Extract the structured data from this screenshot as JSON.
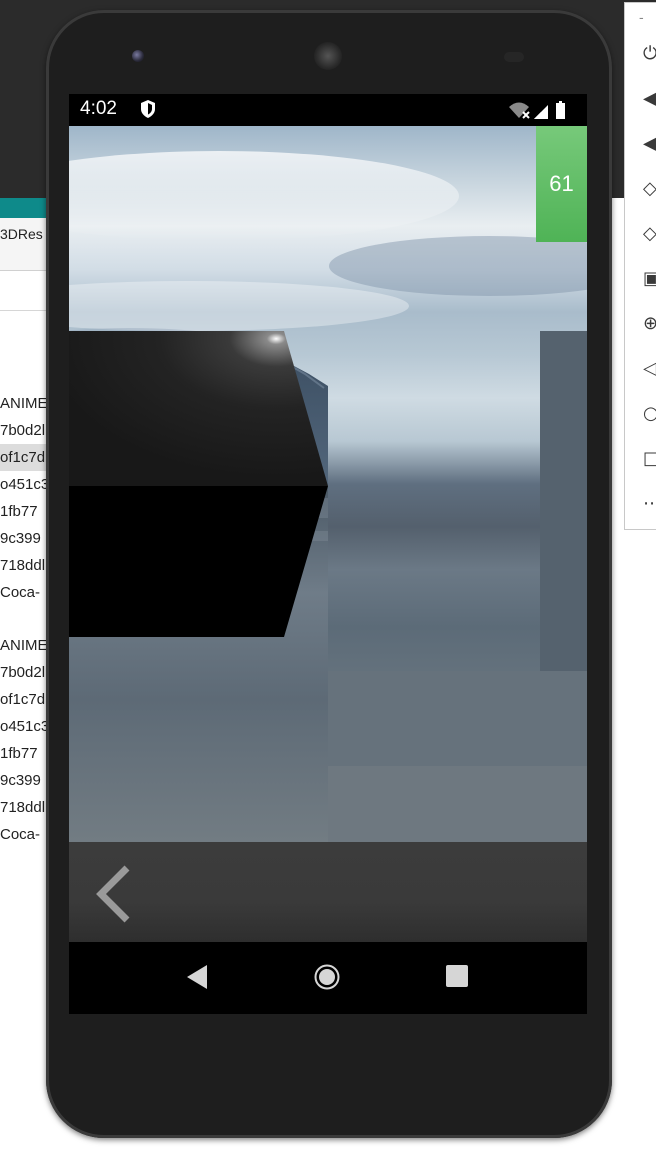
{
  "ide": {
    "tab_label": "3DRes",
    "rows_group1": [
      "ANIME_",
      "7b0d2l",
      "of1c7d",
      "o451c3",
      "1fb77",
      "9c399",
      "718ddl",
      "Coca-"
    ],
    "rows_group2": [
      "ANIME_",
      "7b0d2l",
      "of1c7d",
      "o451c3",
      "1fb77",
      "9c399",
      "718ddl",
      "Coca-"
    ]
  },
  "emulator_toolbar": {
    "close_label": "-",
    "buttons": [
      {
        "name": "power-icon",
        "glyph": "⏻"
      },
      {
        "name": "volume-up-icon",
        "glyph": "◀"
      },
      {
        "name": "volume-down-icon",
        "glyph": "◀"
      },
      {
        "name": "rotate-left-icon",
        "glyph": "◇"
      },
      {
        "name": "rotate-right-icon",
        "glyph": "◇"
      },
      {
        "name": "camera-icon",
        "glyph": "▣"
      },
      {
        "name": "zoom-icon",
        "glyph": "⊕"
      },
      {
        "name": "back-icon",
        "glyph": "◁"
      },
      {
        "name": "home-icon",
        "glyph": "○"
      },
      {
        "name": "overview-icon",
        "glyph": "□"
      },
      {
        "name": "more-icon",
        "glyph": "⋯"
      }
    ]
  },
  "status_bar": {
    "time": "4:02"
  },
  "app": {
    "fps": "61"
  },
  "colors": {
    "fps_badge": "#5cbd63",
    "nav_bar": "#000000",
    "bottom_panel": "#3a3a3a"
  }
}
